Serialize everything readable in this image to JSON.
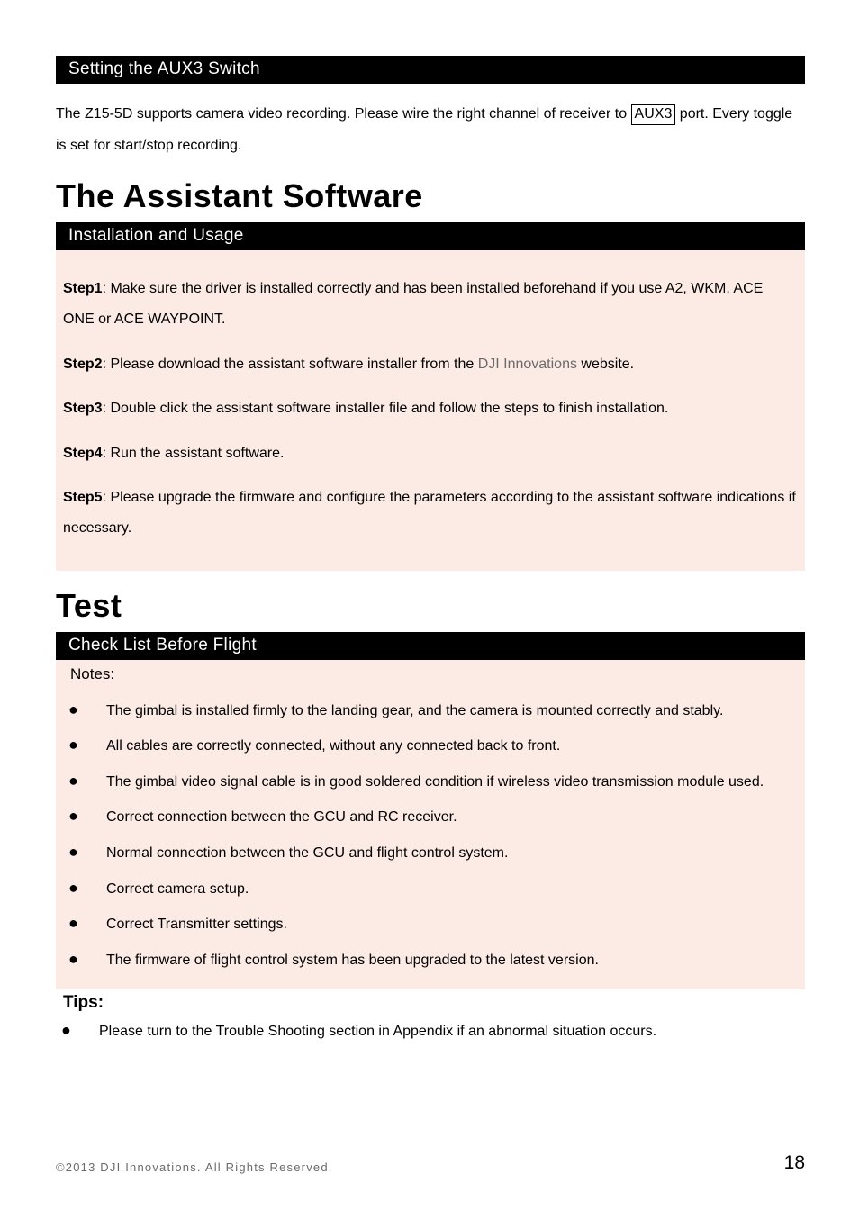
{
  "section_aux3": {
    "bar_title": "Setting the AUX3 Switch",
    "para_pre": "The Z15-5D supports camera video recording. Please wire the right channel of receiver to ",
    "para_boxed": "AUX3",
    "para_post": " port. Every toggle is set for start/stop recording."
  },
  "section_assistant": {
    "title": "The Assistant Software",
    "bar_title": "Installation and Usage",
    "steps": [
      {
        "label": "Step1",
        "sep": ": ",
        "text": "Make sure the driver is installed correctly and has been installed beforehand if you use A2, WKM, ACE ONE or ACE WAYPOINT."
      },
      {
        "label": "Step2",
        "sep": ": ",
        "text_pre": "Please download the assistant software installer from the ",
        "text_link": "DJI Innovations",
        "text_post": " website."
      },
      {
        "label": "Step3",
        "sep": ": ",
        "text": "Double click the assistant software installer file and follow the steps to finish installation."
      },
      {
        "label": "Step4",
        "sep": ": ",
        "text": "Run the assistant software."
      },
      {
        "label": "Step5",
        "sep": ": ",
        "text": "Please upgrade the firmware and configure the parameters according to the assistant software indications if necessary."
      }
    ]
  },
  "section_test": {
    "title": "Test",
    "bar_title": "Check List Before Flight",
    "notes_label": "Notes:",
    "notes_items": [
      "The gimbal is installed firmly to the landing gear, and the camera is mounted correctly and stably.",
      "All cables are correctly connected, without any connected back to front.",
      "The gimbal video signal cable is in good soldered condition if wireless video transmission module used.",
      "Correct connection between the GCU and RC receiver.",
      "Normal connection between the GCU and flight control system.",
      "Correct camera setup.",
      "Correct Transmitter settings.",
      "The firmware of flight control system has been upgraded to the latest version."
    ],
    "tips_label": "Tips:",
    "tips_items": [
      "Please turn to the Trouble Shooting section in Appendix if an abnormal situation occurs."
    ]
  },
  "footer": {
    "copyright": "©2013 DJI Innovations. All Rights Reserved.",
    "page_num": "18"
  }
}
